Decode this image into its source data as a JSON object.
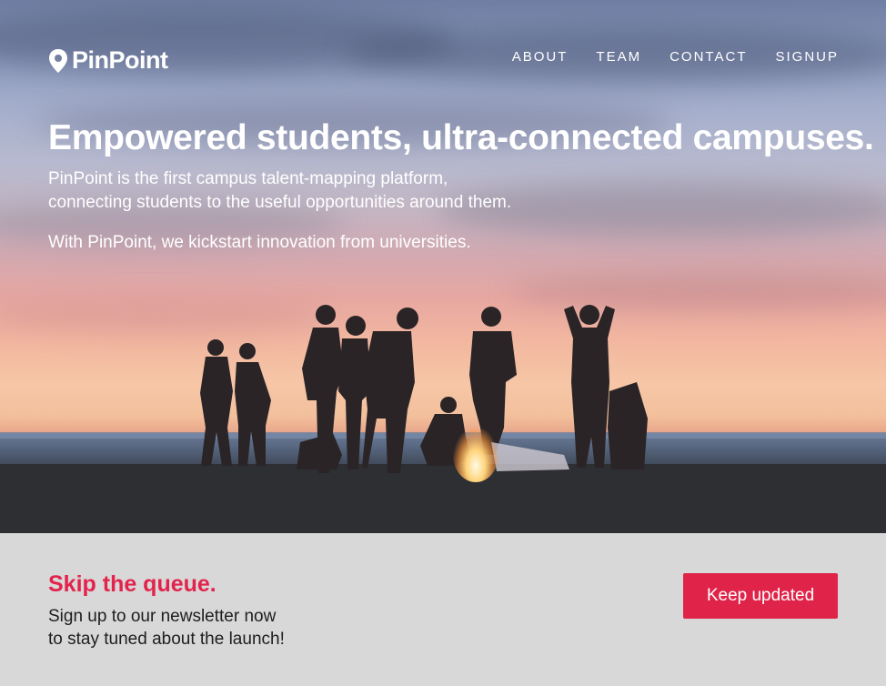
{
  "brand": {
    "name": "PinPoint",
    "icon": "map-pin-icon"
  },
  "nav": {
    "items": [
      {
        "label": "ABOUT"
      },
      {
        "label": "TEAM"
      },
      {
        "label": "CONTACT"
      },
      {
        "label": "SIGNUP"
      }
    ]
  },
  "hero": {
    "headline": "Empowered students, ultra-connected campuses.",
    "line1": "PinPoint is the first campus talent-mapping platform,",
    "line2": "connecting students to the useful opportunities around them.",
    "line3": "With PinPoint, we kickstart innovation from universities."
  },
  "cta": {
    "title": "Skip the queue.",
    "text_line1": "Sign up to our newsletter now",
    "text_line2": "to stay tuned about the launch!",
    "button_label": "Keep updated"
  },
  "colors": {
    "accent": "#e02349",
    "band_background": "#d8d8d8"
  }
}
